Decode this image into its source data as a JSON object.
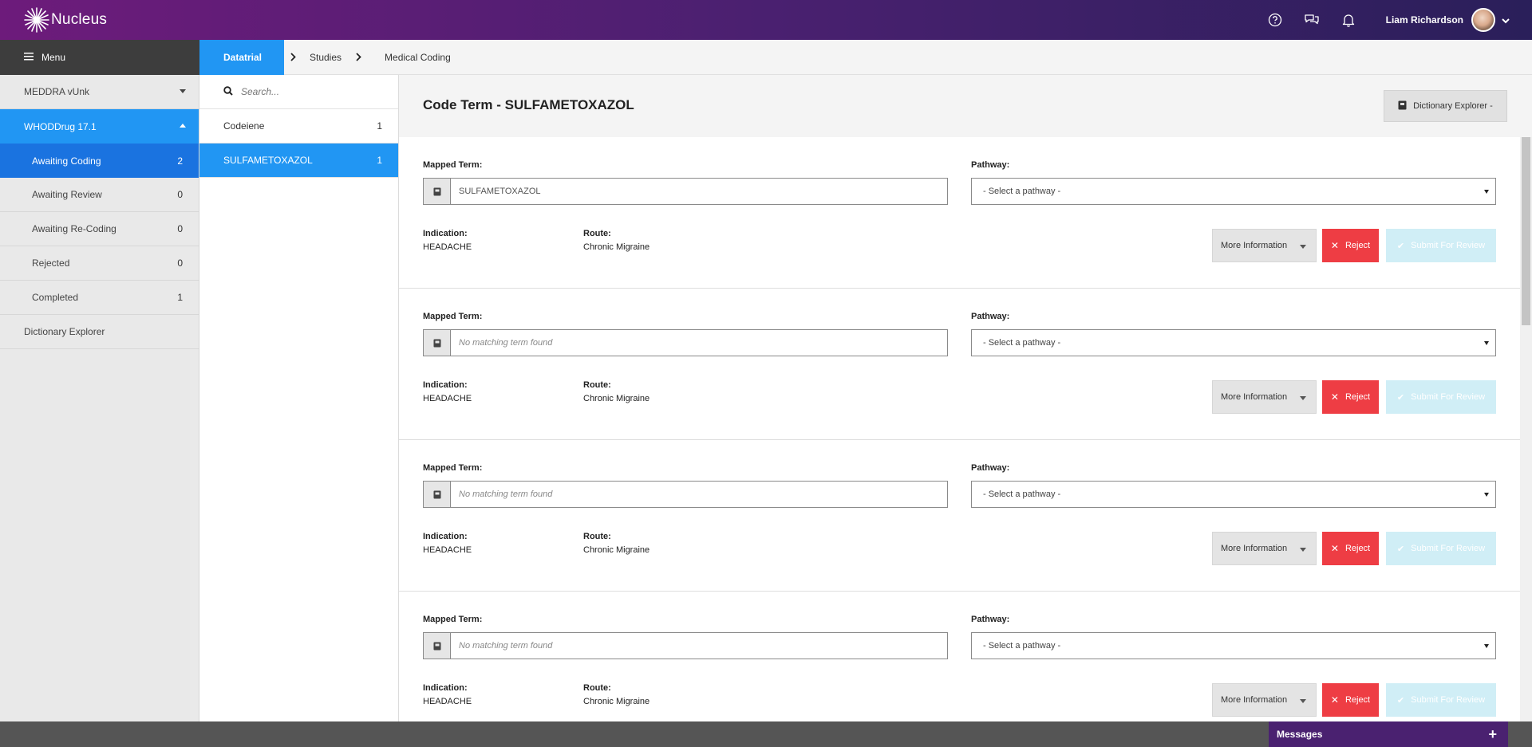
{
  "app": {
    "logo_text": "Nucleus"
  },
  "user": {
    "name": "Liam Richardson"
  },
  "menu": {
    "label": "Menu"
  },
  "breadcrumb": {
    "items": [
      "Datatrial",
      "Studies",
      "Medical Coding"
    ]
  },
  "sidebar": {
    "groups": [
      {
        "label": "MEDDRA vUnk"
      },
      {
        "label": "WHODDrug 17.1"
      }
    ],
    "items": [
      {
        "label": "Awaiting Coding",
        "count": "2"
      },
      {
        "label": "Awaiting Review",
        "count": "0"
      },
      {
        "label": "Awaiting Re-Coding",
        "count": "0"
      },
      {
        "label": "Rejected",
        "count": "0"
      },
      {
        "label": "Completed",
        "count": "1"
      }
    ],
    "dictionary_explorer": "Dictionary Explorer"
  },
  "search": {
    "placeholder": "Search..."
  },
  "terms": [
    {
      "label": "Codeiene",
      "count": "1"
    },
    {
      "label": "SULFAMETOXAZOL",
      "count": "1"
    }
  ],
  "main": {
    "title": "Code Term - SULFAMETOXAZOL",
    "dictionary_button": "Dictionary Explorer -"
  },
  "card_labels": {
    "mapped_term": "Mapped Term:",
    "pathway": "Pathway:",
    "indication": "Indication:",
    "route": "Route:",
    "more_info": "More Information",
    "reject": "Reject",
    "submit": "Submit For Review"
  },
  "cards": [
    {
      "mapped_value": "SULFAMETOXAZOL",
      "pathway_selected": "- Select a pathway -",
      "indication": "HEADACHE",
      "route": "Chronic Migraine"
    },
    {
      "mapped_placeholder": "No matching term found",
      "pathway_selected": "- Select a pathway -",
      "indication": "HEADACHE",
      "route": "Chronic Migraine"
    },
    {
      "mapped_placeholder": "No matching term found",
      "pathway_selected": "- Select a pathway -",
      "indication": "HEADACHE",
      "route": "Chronic Migraine"
    },
    {
      "mapped_placeholder": "No matching term found",
      "pathway_selected": "- Select a pathway -",
      "indication": "HEADACHE",
      "route": "Chronic Migraine"
    }
  ],
  "footer": {
    "messages_label": "Messages"
  },
  "colors": {
    "accent_blue": "#2196f3",
    "active_blue": "#1a73e0",
    "reject_red": "#ee3d44",
    "brand_purple": "#6d1b7b"
  },
  "icons": [
    "logo-icon",
    "help-icon",
    "chat-icon",
    "bell-icon",
    "chevron-down-icon",
    "hamburger-icon",
    "search-icon",
    "book-icon",
    "close-icon",
    "check-icon",
    "plus-icon"
  ]
}
